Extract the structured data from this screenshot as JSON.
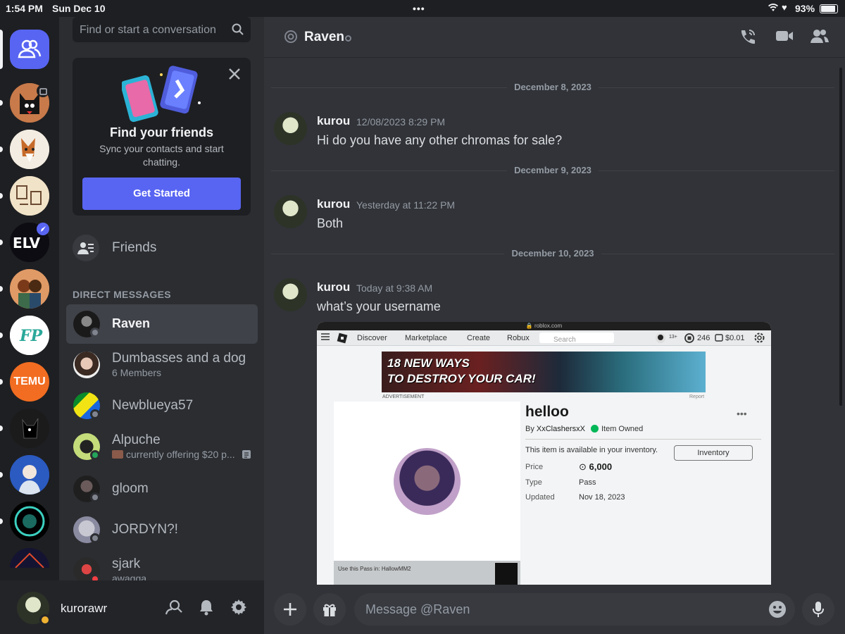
{
  "status": {
    "time": "1:54 PM",
    "date": "Sun Dec 10",
    "battery": "93%",
    "battery_level": 0.93
  },
  "colors": {
    "accent": "#5865f2",
    "online": "#23a55a",
    "dnd": "#f23f43",
    "idle": "#f0b232"
  },
  "search": {
    "placeholder": "Find or start a conversation"
  },
  "friends_card": {
    "title": "Find your friends",
    "subtitle": "Sync your contacts and start chatting.",
    "button": "Get Started"
  },
  "friends_label": "Friends",
  "dm_header": "DIRECT MESSAGES",
  "dms": [
    {
      "name": "Raven",
      "subtitle": ""
    },
    {
      "name": "Dumbasses and a dog",
      "subtitle": "6 Members"
    },
    {
      "name": "Newblueya57",
      "subtitle": ""
    },
    {
      "name": "Alpuche",
      "subtitle": "currently offering $20 p..."
    },
    {
      "name": "gloom",
      "subtitle": ""
    },
    {
      "name": "JORDYN?!",
      "subtitle": ""
    },
    {
      "name": "sjark",
      "subtitle": "awagga"
    }
  ],
  "servers": [
    {
      "label": "TEMU"
    }
  ],
  "user": {
    "name": "kurorawr"
  },
  "chat": {
    "channel": "Raven",
    "input_placeholder": "Message @Raven",
    "dividers": [
      "December 8, 2023",
      "December 9, 2023",
      "December 10, 2023"
    ],
    "messages": [
      {
        "author": "kurou",
        "time": "12/08/2023 8:29 PM",
        "text": "Hi do you have any other chromas for sale?"
      },
      {
        "author": "kurou",
        "time": "Yesterday at 11:22 PM",
        "text": "Both"
      },
      {
        "author": "kurou",
        "time": "Today at 9:38 AM",
        "text": "what’s your username"
      }
    ]
  },
  "attachment": {
    "url": "roblox.com",
    "nav": [
      "Discover",
      "Marketplace",
      "Create",
      "Robux"
    ],
    "search": "Search",
    "age_tag": "13+",
    "robux": "246",
    "balance": "$0.01",
    "ad_text_1": "18 NEW WAYS",
    "ad_text_2": "TO DESTROY YOUR CAR!",
    "ad_label": "ADVERTISEMENT",
    "report": "Report",
    "item_title": "helloo",
    "by_prefix": "By",
    "creator": "XxClashersxX",
    "owned": "Item Owned",
    "available": "This item is available in your inventory.",
    "inventory_button": "Inventory",
    "price_label": "Price",
    "price": "6,000",
    "type_label": "Type",
    "type": "Pass",
    "updated_label": "Updated",
    "updated": "Nov 18, 2023",
    "use_pass": "Use this Pass in:",
    "use_pass_game": "HallowMM2"
  }
}
